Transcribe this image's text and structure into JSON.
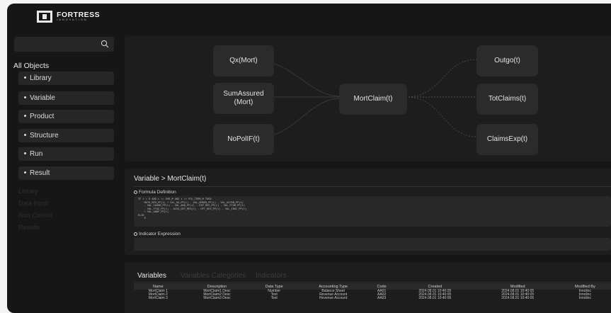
{
  "brand": {
    "name": "FORTRESS",
    "tagline": "INNOVATION"
  },
  "sidebar": {
    "search": {
      "placeholder": "",
      "icon": "search-icon"
    },
    "heading": "All Objects",
    "items": [
      {
        "label": "Library"
      },
      {
        "label": "Variable"
      },
      {
        "label": "Product"
      },
      {
        "label": "Structure"
      },
      {
        "label": "Run"
      },
      {
        "label": "Result"
      }
    ],
    "faint_items": [
      {
        "label": "Library"
      },
      {
        "label": "Data Input"
      },
      {
        "label": "Run Control"
      },
      {
        "label": "Results"
      }
    ]
  },
  "diagram": {
    "inputs": [
      {
        "label": "Qx(Mort)"
      },
      {
        "label": "SumAssured (Mort)"
      },
      {
        "label": "NoPolIF(t)"
      }
    ],
    "center": {
      "label": "MortClaim(t)"
    },
    "outputs": [
      {
        "label": "Outgo(t)"
      },
      {
        "label": "TotClaims(t)"
      },
      {
        "label": "ClaimsExp(t)"
      }
    ]
  },
  "detail": {
    "title": "Variable > MortClaim(t)",
    "formula_label": "Formula Definition",
    "formula_lines": [
      "IF t > 0 AND t <= DUR_M AND t <= POL_TERM_M THEN",
      "    MATH_RES_PP(t) + VAL_SA_PP(t) - VAL_ORBEN_PP(t) - VAL_ACCRB_PP(t)",
      "    - VAL_CASHB_PP(t) - VAL_ANN_PP(t) - EXP_RES_PP(t) - VAL_FCOM_PP(t)",
      "    - VAL_FTAX_PP(t) - AIDS_DEF_RES(t) - OPT_RES_PP(t) - VAL_INDC_PP(t)",
      "    + VAL_ANNP_PP(t)",
      "ELSE",
      "    0"
    ],
    "indicator_label": "Indicator Expression"
  },
  "bottom": {
    "tabs": [
      {
        "label": "Variables"
      },
      {
        "label": "Variables Categories"
      },
      {
        "label": "Indicators"
      }
    ],
    "columns": [
      "Name",
      "Description",
      "Data Type",
      "Accounting Type",
      "Code",
      "Created",
      "Modified",
      "Modified By"
    ],
    "rows": [
      [
        "MortClaim 1",
        "MortClaim1 Desc",
        "Number",
        "Balance Sheet",
        "AA01",
        "2024.08.01 10:40:05",
        "2024.08.01 10:40:05",
        "Innolinc"
      ],
      [
        "MortClaim 2",
        "MortClaim2 Desc",
        "Text",
        "Revenue Account",
        "AA02",
        "2024.08.01 10:40:05",
        "2024.08.01 10:40:05",
        "Innolinc"
      ],
      [
        "MortClaim 3",
        "MortClaim3 Desc",
        "Text",
        "Revenue Account",
        "AA03",
        "2024.08.01 10:40:05",
        "2024.08.01 10:40:05",
        "Innolinc"
      ]
    ]
  },
  "colors": {
    "background": "#161616",
    "panel": "#1d1d1d",
    "node": "#2b2b2b",
    "text": "#e4e4e4"
  }
}
